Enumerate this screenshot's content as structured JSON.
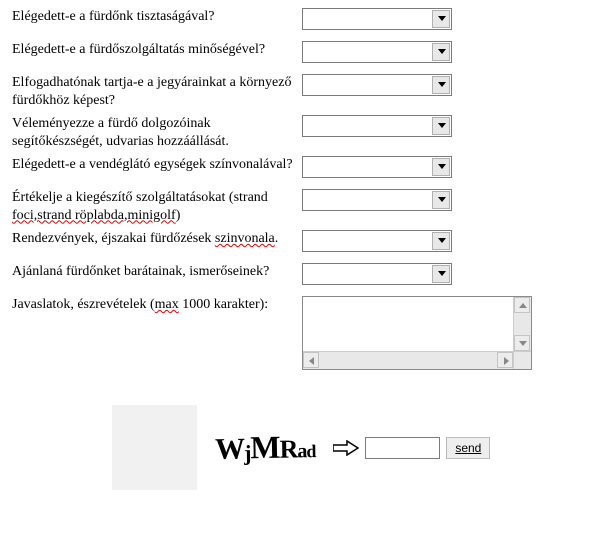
{
  "questions": [
    {
      "label_html": "Elégedett-e a fürdőnk tisztaságával?"
    },
    {
      "label_html": "Elégedett-e a fürdőszolgáltatás minőségével?"
    },
    {
      "label_html": "Elfogadhatónak tartja-e a jegyárainkat a környező fürdőkhöz képest?"
    },
    {
      "label_html": "Véleményezze a fürdő dolgozóinak segítőkészségét, udvarias hozzáállását."
    },
    {
      "label_html": "Elégedett-e a vendéglátó egységek színvonalával?"
    },
    {
      "label_html": "Értékelje a kiegészítő szolgáltatásokat (strand <span class='redline'>foci,strand röplabda,minigolf</span>)"
    },
    {
      "label_html": "Rendezvények, éjszakai fürdőzések <span class='redline'>szinvonala</span>."
    },
    {
      "label_html": "Ajánlaná fürdőnket barátainak, ismerőseinek?"
    }
  ],
  "comments": {
    "label_html": "Javaslatok, észrevételek (<span class='redline'>max</span> 1000 karakter):"
  },
  "captcha": {
    "text": "WjMRad",
    "send_label": "send"
  }
}
